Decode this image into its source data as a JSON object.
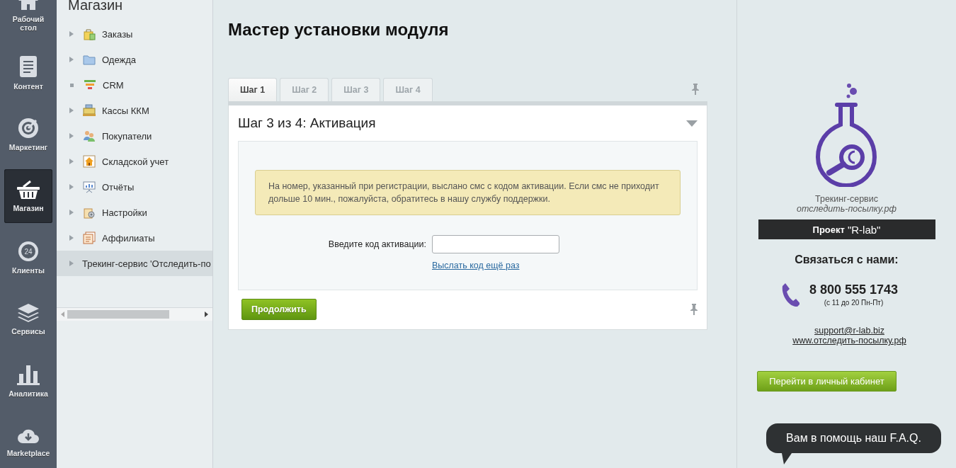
{
  "rail": {
    "items": [
      {
        "label": "Рабочий стол",
        "selected": false
      },
      {
        "label": "Контент",
        "selected": false
      },
      {
        "label": "Маркетинг",
        "selected": false
      },
      {
        "label": "Магазин",
        "selected": true
      },
      {
        "label": "Клиенты",
        "selected": false,
        "icon_text": "24"
      },
      {
        "label": "Сервисы",
        "selected": false
      },
      {
        "label": "Аналитика",
        "selected": false
      },
      {
        "label": "Marketplace",
        "selected": false
      }
    ]
  },
  "menu": {
    "title": "Магазин",
    "items": [
      {
        "label": "Заказы",
        "kind": "expandable",
        "selected": false
      },
      {
        "label": "Одежда",
        "kind": "expandable",
        "selected": false
      },
      {
        "label": "CRM",
        "kind": "leaf",
        "selected": false
      },
      {
        "label": "Кассы ККМ",
        "kind": "expandable",
        "selected": false
      },
      {
        "label": "Покупатели",
        "kind": "expandable",
        "selected": false
      },
      {
        "label": "Складской учет",
        "kind": "expandable",
        "selected": false
      },
      {
        "label": "Отчёты",
        "kind": "expandable",
        "selected": false
      },
      {
        "label": "Настройки",
        "kind": "expandable",
        "selected": false
      },
      {
        "label": "Аффилиаты",
        "kind": "expandable",
        "selected": false
      },
      {
        "label": "Трекинг-сервис 'Отследить-по",
        "kind": "expandable",
        "selected": true
      }
    ]
  },
  "wizard": {
    "title": "Мастер установки модуля",
    "tabs": [
      {
        "label": "Шаг 1",
        "selected": true
      },
      {
        "label": "Шаг 2",
        "selected": false
      },
      {
        "label": "Шаг 3",
        "selected": false
      },
      {
        "label": "Шаг 4",
        "selected": false
      }
    ],
    "panel": {
      "heading": "Шаг 3 из 4: Активация",
      "expanded": true,
      "notice": "На номер, указанный при регистрации, выслано смс с кодом активации. Если смс не приходит дольше 10 мин., пожалуйста, обратитесь в нашу службу поддержки.",
      "field_label": "Введите код активации:",
      "resend_link": "Выслать код ещё раз",
      "continue_button": "Продолжить"
    }
  },
  "promo": {
    "service_name": "Трекинг-сервис",
    "service_domain": "отследить-посылку.рф",
    "project_prefix": "Проект",
    "project_name": "\"R-lab\"",
    "contact_heading": "Связаться с нами:",
    "phone": "8 800 555 1743",
    "hours": "(с 11 до 20 Пн-Пт)",
    "email": "support@r-lab.biz",
    "website": "www.отследить-посылку.рф",
    "cabinet_button": "Перейти в личный кабинет",
    "faq_bubble": "Вам в помощь наш F.A.Q."
  }
}
